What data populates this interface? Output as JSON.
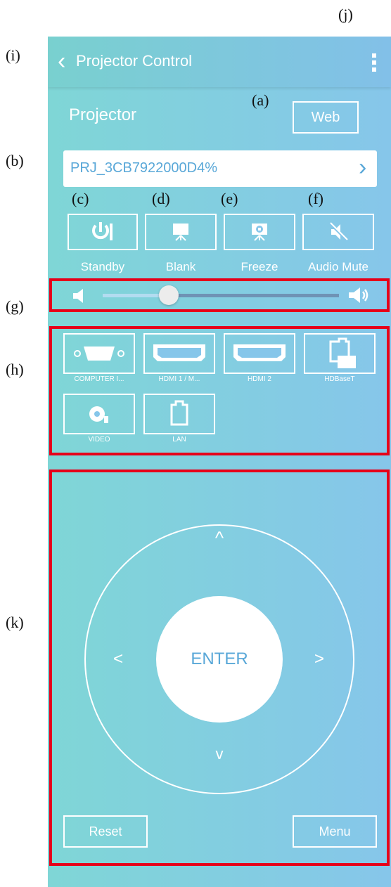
{
  "annotations": {
    "a": "(a)",
    "b": "(b)",
    "c": "(c)",
    "d": "(d)",
    "e": "(e)",
    "f": "(f)",
    "g": "(g)",
    "h": "(h)",
    "i": "(i)",
    "j": "(j)",
    "k": "(k)"
  },
  "header": {
    "back_glyph": "‹",
    "title": "Projector Control",
    "menu_icon": "more-vertical-icon"
  },
  "projector": {
    "label": "Projector",
    "web_button": "Web",
    "selected": "PRJ_3CB7922000D4%",
    "chevron": "›"
  },
  "controls": [
    {
      "label": "Standby",
      "icon": "power-icon"
    },
    {
      "label": "Blank",
      "icon": "blank-screen-icon"
    },
    {
      "label": "Freeze",
      "icon": "freeze-icon"
    },
    {
      "label": "Audio Mute",
      "icon": "speaker-mute-icon"
    }
  ],
  "volume": {
    "level": 0.28
  },
  "sources": [
    {
      "label": "COMPUTER I...",
      "icon": "vga-port-icon"
    },
    {
      "label": "HDMI 1 / M...",
      "icon": "hdmi-port-icon"
    },
    {
      "label": "HDMI 2",
      "icon": "hdmi-port-icon"
    },
    {
      "label": "HDBaseT",
      "icon": "hdbaset-port-icon"
    },
    {
      "label": "VIDEO",
      "icon": "video-input-icon"
    },
    {
      "label": "LAN",
      "icon": "lan-port-icon"
    }
  ],
  "dpad": {
    "enter": "ENTER",
    "up": "^",
    "down": "v",
    "left": "<",
    "right": ">"
  },
  "bottom": {
    "reset": "Reset",
    "menu": "Menu"
  },
  "colors": {
    "frame": "#e6001a",
    "accent": "#5aa8d8",
    "panel_start": "#7fd6d6",
    "panel_end": "#86c6ea"
  }
}
